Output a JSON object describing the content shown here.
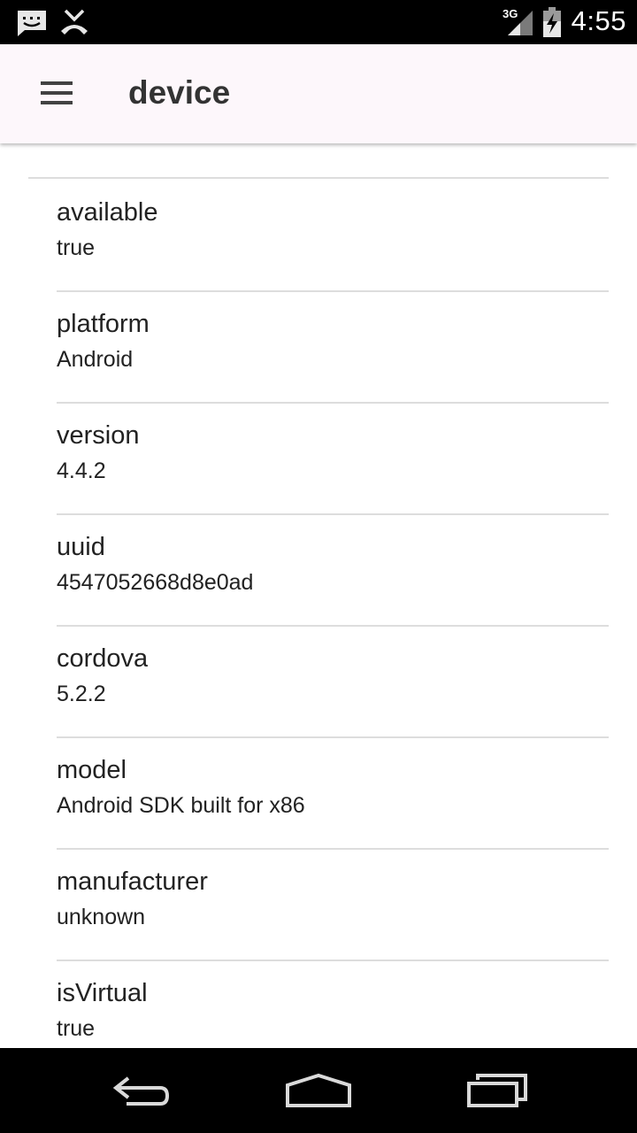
{
  "status_bar": {
    "network": "3G",
    "time": "4:55",
    "icons": [
      "message-icon",
      "missed-call-icon",
      "signal-icon",
      "battery-charging-icon"
    ]
  },
  "app_bar": {
    "title": "device",
    "menu_icon": "hamburger-menu-icon"
  },
  "properties": [
    {
      "key": "available",
      "value": "true"
    },
    {
      "key": "platform",
      "value": "Android"
    },
    {
      "key": "version",
      "value": "4.4.2"
    },
    {
      "key": "uuid",
      "value": "4547052668d8e0ad"
    },
    {
      "key": "cordova",
      "value": "5.2.2"
    },
    {
      "key": "model",
      "value": "Android SDK built for x86"
    },
    {
      "key": "manufacturer",
      "value": "unknown"
    },
    {
      "key": "isVirtual",
      "value": "true"
    }
  ],
  "nav_bar": {
    "icons": [
      "back-icon",
      "home-icon",
      "recent-apps-icon"
    ]
  }
}
